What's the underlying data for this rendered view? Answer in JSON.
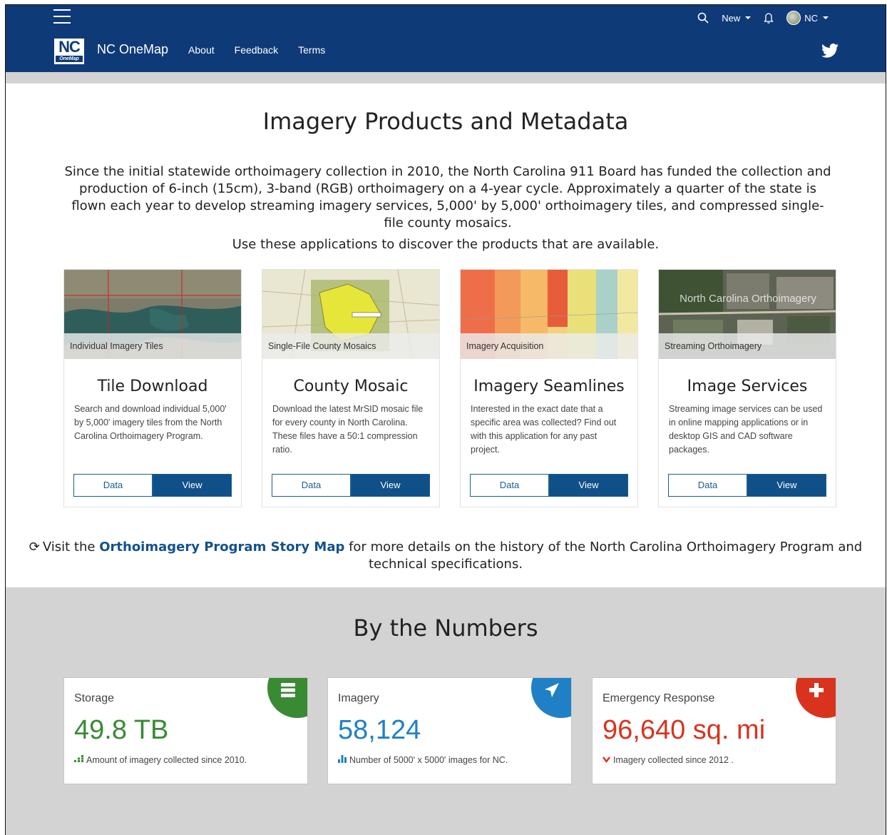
{
  "header": {
    "brand": "NC OneMap",
    "logo_text": "NC",
    "logo_sub": "OneMap",
    "nav": [
      "About",
      "Feedback",
      "Terms"
    ],
    "new_label": "New",
    "user_label": "NC"
  },
  "main": {
    "title": "Imagery Products and Metadata",
    "intro": "Since the initial statewide orthoimagery collection in 2010, the North Carolina 911 Board has funded the collection and production of 6-inch (15cm), 3-band (RGB) orthoimagery on a 4-year cycle. Approximately a quarter of the state is flown each year to develop streaming imagery services, 5,000' by 5,000' orthoimagery tiles, and compressed single-file county mosaics.",
    "intro_sub": "Use these applications to discover the products that are available.",
    "cards": [
      {
        "caption": "Individual Imagery Tiles",
        "title": "Tile Download",
        "text": "Search and download individual 5,000' by 5,000' imagery tiles from the North Carolina Orthoimagery Program.",
        "data_label": "Data",
        "view_label": "View"
      },
      {
        "caption": "Single-File County Mosaics",
        "title": "County Mosaic",
        "text": "Download the latest MrSID mosaic file for every county in North Carolina. These files have a 50:1 compression ratio.",
        "data_label": "Data",
        "view_label": "View"
      },
      {
        "caption": "Imagery Acquisition",
        "title": "Imagery Seamlines",
        "text": "Interested in the exact date that a specific area was collected? Find out with this application for any past project.",
        "data_label": "Data",
        "view_label": "View"
      },
      {
        "caption": "Streaming Orthoimagery",
        "overlay": "North Carolina Orthoimagery",
        "title": "Image Services",
        "text": "Streaming image services can be used in online mapping applications or in desktop GIS and CAD software packages.",
        "data_label": "Data",
        "view_label": "View"
      }
    ],
    "story_prefix": "Visit the",
    "story_link": "Orthoimagery Program Story Map",
    "story_suffix": "for more details on the history of the North Carolina Orthoimagery Program and technical specifications."
  },
  "numbers": {
    "title": "By the Numbers",
    "stats": [
      {
        "label": "Storage",
        "value": "49.8 TB",
        "desc": "Amount of imagery collected since 2010.",
        "color": "#3a8a34"
      },
      {
        "label": "Imagery",
        "value": "58,124",
        "desc": "Number of 5000' x 5000' images for NC.",
        "color": "#1f80c6"
      },
      {
        "label": "Emergency Response",
        "value": "96,640 sq. mi",
        "desc": "Imagery collected since 2012 .",
        "color": "#d9331d"
      }
    ]
  },
  "colors": {
    "header_bg": "#0f3a78",
    "button_view": "#0f5089",
    "link": "#12518f",
    "section_gray": "#d3d3d3"
  }
}
